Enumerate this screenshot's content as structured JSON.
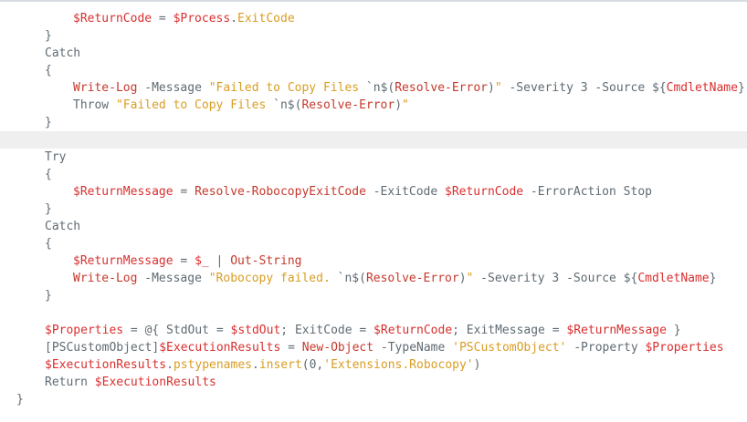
{
  "editor": {
    "lines": [
      {
        "indent": 2,
        "tokens": [
          {
            "t": "var",
            "v": "$ReturnCode"
          },
          {
            "t": "plain",
            "v": " = "
          },
          {
            "t": "var",
            "v": "$Process"
          },
          {
            "t": "plain",
            "v": "."
          },
          {
            "t": "prop",
            "v": "ExitCode"
          }
        ]
      },
      {
        "indent": 1,
        "tokens": [
          {
            "t": "plain",
            "v": "}"
          }
        ]
      },
      {
        "indent": 1,
        "tokens": [
          {
            "t": "plain",
            "v": "Catch"
          }
        ]
      },
      {
        "indent": 1,
        "tokens": [
          {
            "t": "plain",
            "v": "{"
          }
        ]
      },
      {
        "indent": 2,
        "tokens": [
          {
            "t": "cmd",
            "v": "Write-Log"
          },
          {
            "t": "plain",
            "v": " -Message "
          },
          {
            "t": "str",
            "v": "\"Failed to Copy Files "
          },
          {
            "t": "plain",
            "v": "`n$("
          },
          {
            "t": "cmd",
            "v": "Resolve-Error"
          },
          {
            "t": "plain",
            "v": ")"
          },
          {
            "t": "str",
            "v": "\""
          },
          {
            "t": "plain",
            "v": " -Severity 3 -Source ${"
          },
          {
            "t": "var",
            "v": "CmdletName"
          },
          {
            "t": "plain",
            "v": "}"
          }
        ]
      },
      {
        "indent": 2,
        "tokens": [
          {
            "t": "plain",
            "v": "Throw "
          },
          {
            "t": "str",
            "v": "\"Failed to Copy Files "
          },
          {
            "t": "plain",
            "v": "`n$("
          },
          {
            "t": "cmd",
            "v": "Resolve-Error"
          },
          {
            "t": "plain",
            "v": ")"
          },
          {
            "t": "str",
            "v": "\""
          }
        ]
      },
      {
        "indent": 1,
        "tokens": [
          {
            "t": "plain",
            "v": "}"
          }
        ]
      },
      {
        "indent": 0,
        "highlight": true,
        "tokens": []
      },
      {
        "indent": 1,
        "tokens": [
          {
            "t": "plain",
            "v": "Try"
          }
        ]
      },
      {
        "indent": 1,
        "tokens": [
          {
            "t": "plain",
            "v": "{"
          }
        ]
      },
      {
        "indent": 2,
        "tokens": [
          {
            "t": "var",
            "v": "$ReturnMessage"
          },
          {
            "t": "plain",
            "v": " = "
          },
          {
            "t": "cmd",
            "v": "Resolve-RobocopyExitCode"
          },
          {
            "t": "plain",
            "v": " -ExitCode "
          },
          {
            "t": "var",
            "v": "$ReturnCode"
          },
          {
            "t": "plain",
            "v": " -ErrorAction Stop"
          }
        ]
      },
      {
        "indent": 1,
        "tokens": [
          {
            "t": "plain",
            "v": "}"
          }
        ]
      },
      {
        "indent": 1,
        "tokens": [
          {
            "t": "plain",
            "v": "Catch"
          }
        ]
      },
      {
        "indent": 1,
        "tokens": [
          {
            "t": "plain",
            "v": "{"
          }
        ]
      },
      {
        "indent": 2,
        "tokens": [
          {
            "t": "var",
            "v": "$ReturnMessage"
          },
          {
            "t": "plain",
            "v": " = "
          },
          {
            "t": "var",
            "v": "$_"
          },
          {
            "t": "plain",
            "v": " | "
          },
          {
            "t": "cmd",
            "v": "Out-String"
          }
        ]
      },
      {
        "indent": 2,
        "tokens": [
          {
            "t": "cmd",
            "v": "Write-Log"
          },
          {
            "t": "plain",
            "v": " -Message "
          },
          {
            "t": "str",
            "v": "\"Robocopy failed. "
          },
          {
            "t": "plain",
            "v": "`n$("
          },
          {
            "t": "cmd",
            "v": "Resolve-Error"
          },
          {
            "t": "plain",
            "v": ")"
          },
          {
            "t": "str",
            "v": "\""
          },
          {
            "t": "plain",
            "v": " -Severity 3 -Source ${"
          },
          {
            "t": "var",
            "v": "CmdletName"
          },
          {
            "t": "plain",
            "v": "}"
          }
        ]
      },
      {
        "indent": 1,
        "tokens": [
          {
            "t": "plain",
            "v": "}"
          }
        ]
      },
      {
        "indent": 0,
        "tokens": []
      },
      {
        "indent": 1,
        "tokens": [
          {
            "t": "var",
            "v": "$Properties"
          },
          {
            "t": "plain",
            "v": " = @{ StdOut = "
          },
          {
            "t": "var",
            "v": "$stdOut"
          },
          {
            "t": "plain",
            "v": "; ExitCode = "
          },
          {
            "t": "var",
            "v": "$ReturnCode"
          },
          {
            "t": "plain",
            "v": "; ExitMessage = "
          },
          {
            "t": "var",
            "v": "$ReturnMessage"
          },
          {
            "t": "plain",
            "v": " }"
          }
        ]
      },
      {
        "indent": 1,
        "tokens": [
          {
            "t": "plain",
            "v": "[PSCustomObject]"
          },
          {
            "t": "var",
            "v": "$ExecutionResults"
          },
          {
            "t": "plain",
            "v": " = "
          },
          {
            "t": "cmd",
            "v": "New-Object"
          },
          {
            "t": "plain",
            "v": " -TypeName "
          },
          {
            "t": "str",
            "v": "'PSCustomObject'"
          },
          {
            "t": "plain",
            "v": " -Property "
          },
          {
            "t": "var",
            "v": "$Properties"
          }
        ]
      },
      {
        "indent": 1,
        "tokens": [
          {
            "t": "var",
            "v": "$ExecutionResults"
          },
          {
            "t": "plain",
            "v": "."
          },
          {
            "t": "prop",
            "v": "pstypenames"
          },
          {
            "t": "plain",
            "v": "."
          },
          {
            "t": "prop",
            "v": "insert"
          },
          {
            "t": "plain",
            "v": "(0,"
          },
          {
            "t": "str",
            "v": "'Extensions.Robocopy'"
          },
          {
            "t": "plain",
            "v": ")"
          }
        ]
      },
      {
        "indent": 1,
        "tokens": [
          {
            "t": "plain",
            "v": "Return "
          },
          {
            "t": "var",
            "v": "$ExecutionResults"
          }
        ]
      },
      {
        "indent": 0,
        "tokens": [
          {
            "t": "plain",
            "v": "}"
          }
        ]
      }
    ]
  }
}
